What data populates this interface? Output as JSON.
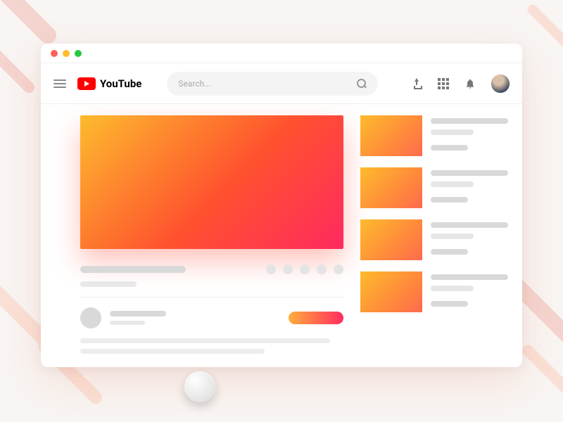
{
  "brand": {
    "name": "YouTube"
  },
  "search": {
    "placeholder": "Search..."
  },
  "colors": {
    "gradient_start": "#fdbb2d",
    "gradient_mid": "#ff512f",
    "gradient_end": "#ff2a5f",
    "brand_red": "#ff0000"
  },
  "icons": {
    "upload": "upload-icon",
    "apps": "apps-grid-icon",
    "notifications": "bell-icon",
    "menu": "hamburger-menu-icon",
    "search": "search-icon"
  },
  "suggestions_count": 4
}
